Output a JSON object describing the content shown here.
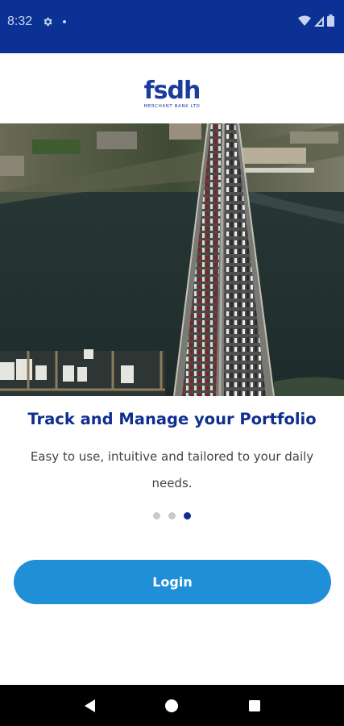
{
  "status_bar": {
    "time": "8:32",
    "icons": [
      "gear-icon",
      "notification-dot-icon",
      "wifi-icon",
      "signal-icon",
      "battery-icon"
    ]
  },
  "brand": {
    "logo_text": "fsdh",
    "logo_subtext": "MERCHANT BANK LTD",
    "primary_color": "#0f2f8f",
    "status_bar_color": "#0b3194",
    "button_color": "#1f8fd8"
  },
  "hero": {
    "image": "aerial-bridge-traffic-photo"
  },
  "onboarding": {
    "title": "Track and Manage your Portfolio",
    "description": "Easy to use, intuitive and tailored to your daily needs.",
    "page_count": 3,
    "active_page": 3
  },
  "actions": {
    "login_label": "Login"
  },
  "nav": {
    "icons": [
      "back-icon",
      "home-icon",
      "recents-icon"
    ]
  }
}
